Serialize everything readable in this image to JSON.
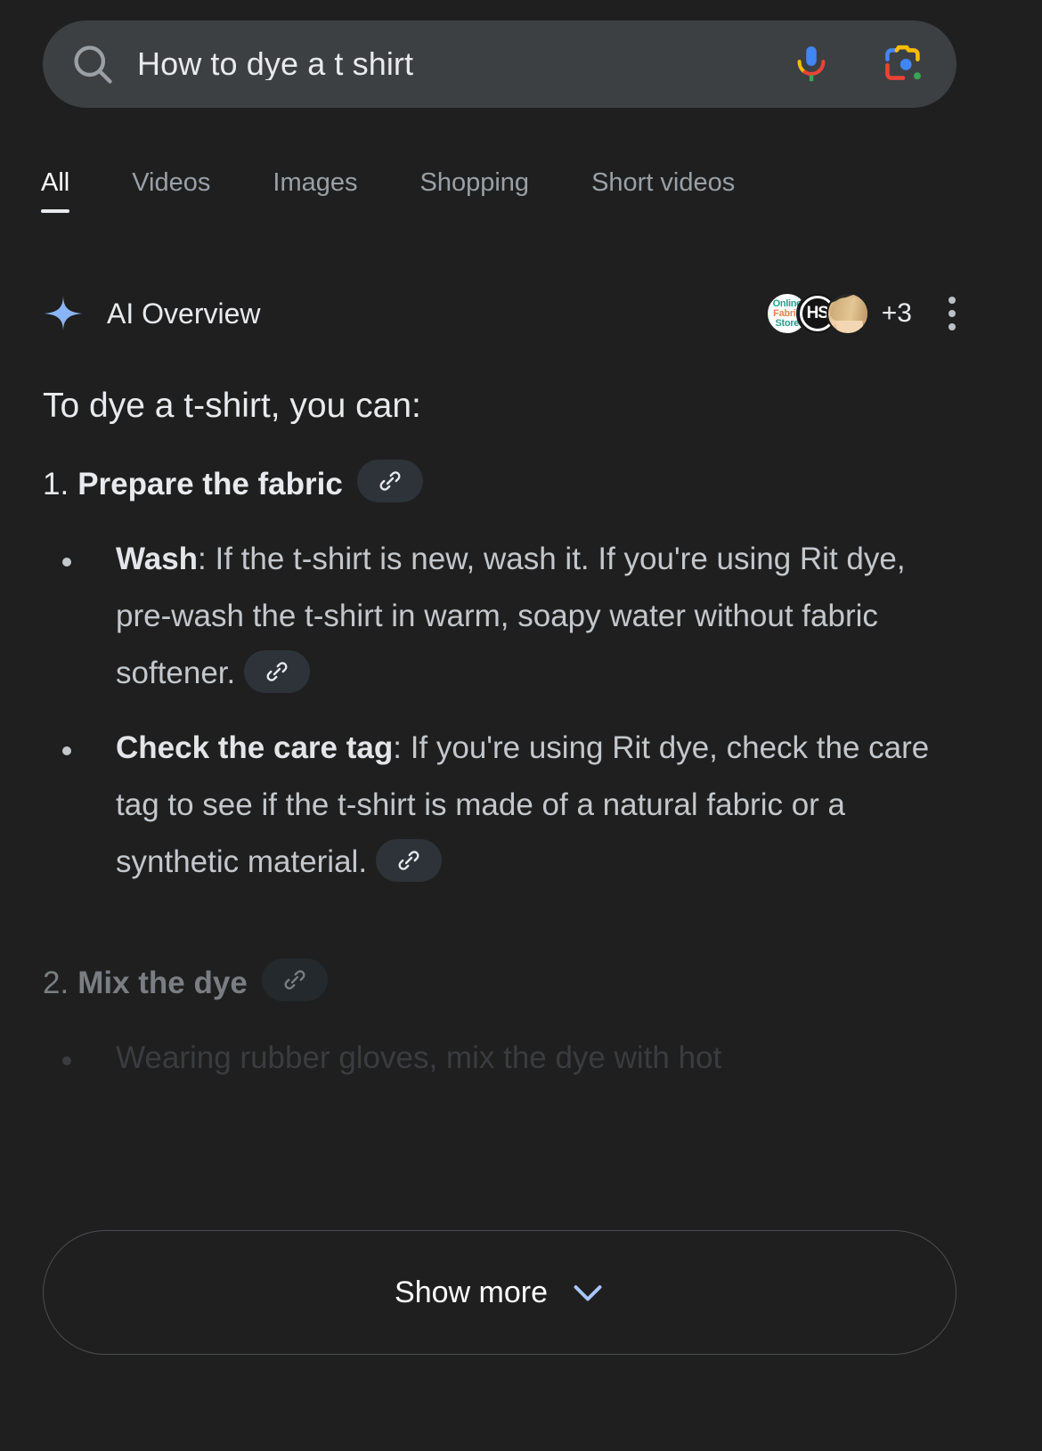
{
  "search": {
    "query": "How to dye a t shirt",
    "placeholder": "Search",
    "search_icon": "search-icon",
    "mic_icon": "microphone-icon",
    "lens_icon": "google-lens-icon"
  },
  "tabs": [
    {
      "label": "All",
      "active": true
    },
    {
      "label": "Videos",
      "active": false
    },
    {
      "label": "Images",
      "active": false
    },
    {
      "label": "Shopping",
      "active": false
    },
    {
      "label": "Short videos",
      "active": false
    }
  ],
  "ai_overview": {
    "title": "AI Overview",
    "sparkle_icon": "ai-sparkle-icon",
    "sources": {
      "extra_count_label": "+3",
      "avatars": [
        {
          "name": "online-fabric-store",
          "line1": "Online",
          "line2": "Fabric",
          "line3": "Store"
        },
        {
          "name": "hs-source",
          "initials": "HS"
        },
        {
          "name": "person-photo-source",
          "initials": ""
        }
      ]
    },
    "menu_icon": "three-dot-menu-icon",
    "intro": "To dye a t-shirt, you can:",
    "link_chip_icon": "link-chip-icon",
    "steps": [
      {
        "number": "1.",
        "title": "Prepare the fabric",
        "has_link_chip": true,
        "bullets": [
          {
            "lead": "Wash",
            "separator": ": ",
            "text": "If the t-shirt is new, wash it. If you're using Rit dye, pre-wash the t-shirt in warm, soapy water without fabric softener.",
            "has_link_chip": true
          },
          {
            "lead": "Check the care tag",
            "separator": ": ",
            "text": "If you're using Rit dye, check the care tag to see if the t-shirt is made of a natural fabric or a synthetic material.",
            "has_link_chip": true
          }
        ]
      },
      {
        "number": "2.",
        "title": "Mix the dye",
        "has_link_chip": true,
        "faded_bullet": "Wearing rubber gloves, mix the dye with hot"
      }
    ]
  },
  "show_more": {
    "label": "Show more",
    "chevron_icon": "chevron-down-icon"
  },
  "colors": {
    "background": "#1f1f1f",
    "searchbar_bg": "#3c4043",
    "text_primary": "#e8eaed",
    "text_secondary": "#c4c7cb",
    "text_muted": "#9aa0a6",
    "sparkle_blue": "#8ab4f8",
    "chip_bg": "#2d3339",
    "google_blue": "#4285f4",
    "google_red": "#ea4335",
    "google_yellow": "#fbbc05",
    "google_green": "#34a853"
  }
}
